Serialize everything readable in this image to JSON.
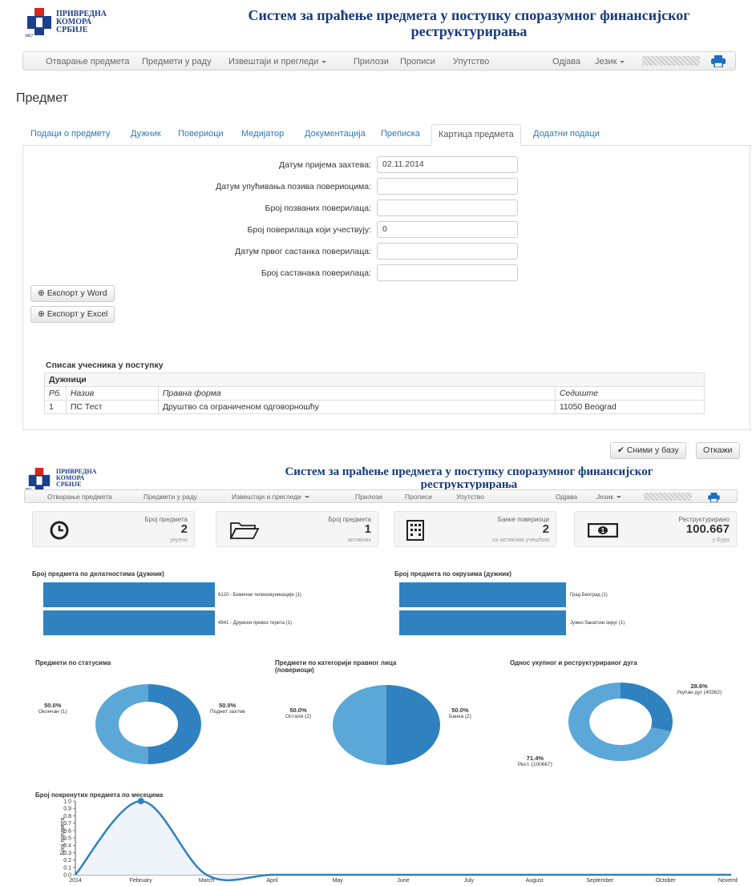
{
  "header": {
    "org_line1": "ПРИВРЕДНА",
    "org_line2": "КОМОРА",
    "org_line3": "СРБИЈЕ",
    "org_year": "1857",
    "title_line1": "Систем за праћење предмета у поступку споразумног финансијског",
    "title_line2": "реструктурирања"
  },
  "nav": {
    "items": [
      "Отварање предмета",
      "Предмети у раду",
      "Извештаји и прегледи",
      "Прилози",
      "Прописи",
      "Упутство"
    ],
    "logout": "Одјава",
    "language": "Језик"
  },
  "page": {
    "title": "Предмет",
    "tabs": [
      "Подаци о предмету",
      "Дужник",
      "Повериоци",
      "Медијатор",
      "Документација",
      "Преписка",
      "Картица предмета",
      "Додатни подаци"
    ],
    "active_tab": "Картица предмета"
  },
  "form": {
    "fields": [
      {
        "label": "Датум пријема захтева:",
        "value": "02.11.2014"
      },
      {
        "label": "Датум упућивања позива повериоцима:",
        "value": ""
      },
      {
        "label": "Број позваних поверилаца:",
        "value": ""
      },
      {
        "label": "Број поверилаца који учествују:",
        "value": "0"
      },
      {
        "label": "Датум првог састанка поверилаца:",
        "value": ""
      },
      {
        "label": "Број састанака поверилаца:",
        "value": ""
      }
    ],
    "export_word": "Експорт у Word",
    "export_excel": "Експорт у Excel"
  },
  "participants": {
    "title": "Списак учесника у поступку",
    "group": "Дужници",
    "columns": [
      "Рб.",
      "Назив",
      "Правна форма",
      "Седиште"
    ],
    "rows": [
      [
        "1",
        "ПС Тест",
        "Друштво са ограниченом одговорношћу",
        "11050 Beograd"
      ]
    ]
  },
  "actions": {
    "save": "Сними у базу",
    "cancel": "Откажи"
  },
  "dashboard": {
    "stats": [
      {
        "title": "Број предмета",
        "value": "2",
        "sub": "укупно",
        "icon": "clock-icon"
      },
      {
        "title": "Број предмета",
        "value": "1",
        "sub": "активних",
        "icon": "folder-icon"
      },
      {
        "title": "Банке повериоци",
        "value": "2",
        "sub": "са активним учешћем",
        "icon": "building-icon"
      },
      {
        "title": "Реструктурирано",
        "value": "100.667",
        "sub": "у Еуро",
        "icon": "banknote-icon"
      }
    ],
    "bars_activity": {
      "title": "Број предмета по делатностима (дужник)",
      "items": [
        {
          "label": "6120 - Бежичне телекомуникације (1)",
          "value": 1
        },
        {
          "label": "4941 - Друмски превоз терета (1)",
          "value": 1
        }
      ]
    },
    "bars_district": {
      "title": "Број предмета по окрузима (дужник)",
      "items": [
        {
          "label": "Град Београд (1)",
          "value": 1
        },
        {
          "label": "Јужно банатски округ (1)",
          "value": 1
        }
      ]
    },
    "pie_status": {
      "title": "Предмети по статусима",
      "slices": [
        {
          "pct": "50.0%",
          "label": "Поднет захтев",
          "value": 50
        },
        {
          "pct": "50.0%",
          "label": "Окончан (1)",
          "value": 50
        }
      ]
    },
    "pie_category": {
      "title_line1": "Предмети по категорији правног лица",
      "title_line2": "(повериоци)",
      "slices": [
        {
          "pct": "50.0%",
          "label": "Банка (2)",
          "value": 50
        },
        {
          "pct": "50.0%",
          "label": "Остали (2)",
          "value": 50
        }
      ]
    },
    "pie_debt": {
      "title": "Однос укупног и реструктурираног дуга",
      "slices": [
        {
          "pct": "28.6%",
          "label": "Укупан дуг (40362)",
          "value": 28.6
        },
        {
          "pct": "71.4%",
          "label": "Рест. (100667)",
          "value": 71.4
        }
      ]
    },
    "colors": {
      "dark": "#2f81bf",
      "light": "#5ba7d8"
    }
  },
  "chart_data": {
    "type": "line",
    "title": "Број покренутих предмета по месецима",
    "ylabel": "Број предмета",
    "categories": [
      "2014",
      "February",
      "March",
      "April",
      "May",
      "June",
      "July",
      "August",
      "September",
      "October",
      "November"
    ],
    "values": [
      0,
      1,
      0,
      0,
      0,
      0,
      0,
      0,
      0,
      0,
      0
    ],
    "yticks": [
      "0.0",
      "0.1",
      "0.2",
      "0.3",
      "0.4",
      "0.5",
      "0.6",
      "0.7",
      "0.8",
      "0.9",
      "1.0"
    ],
    "ylim": [
      0,
      1
    ],
    "color": "#2f81bf"
  }
}
